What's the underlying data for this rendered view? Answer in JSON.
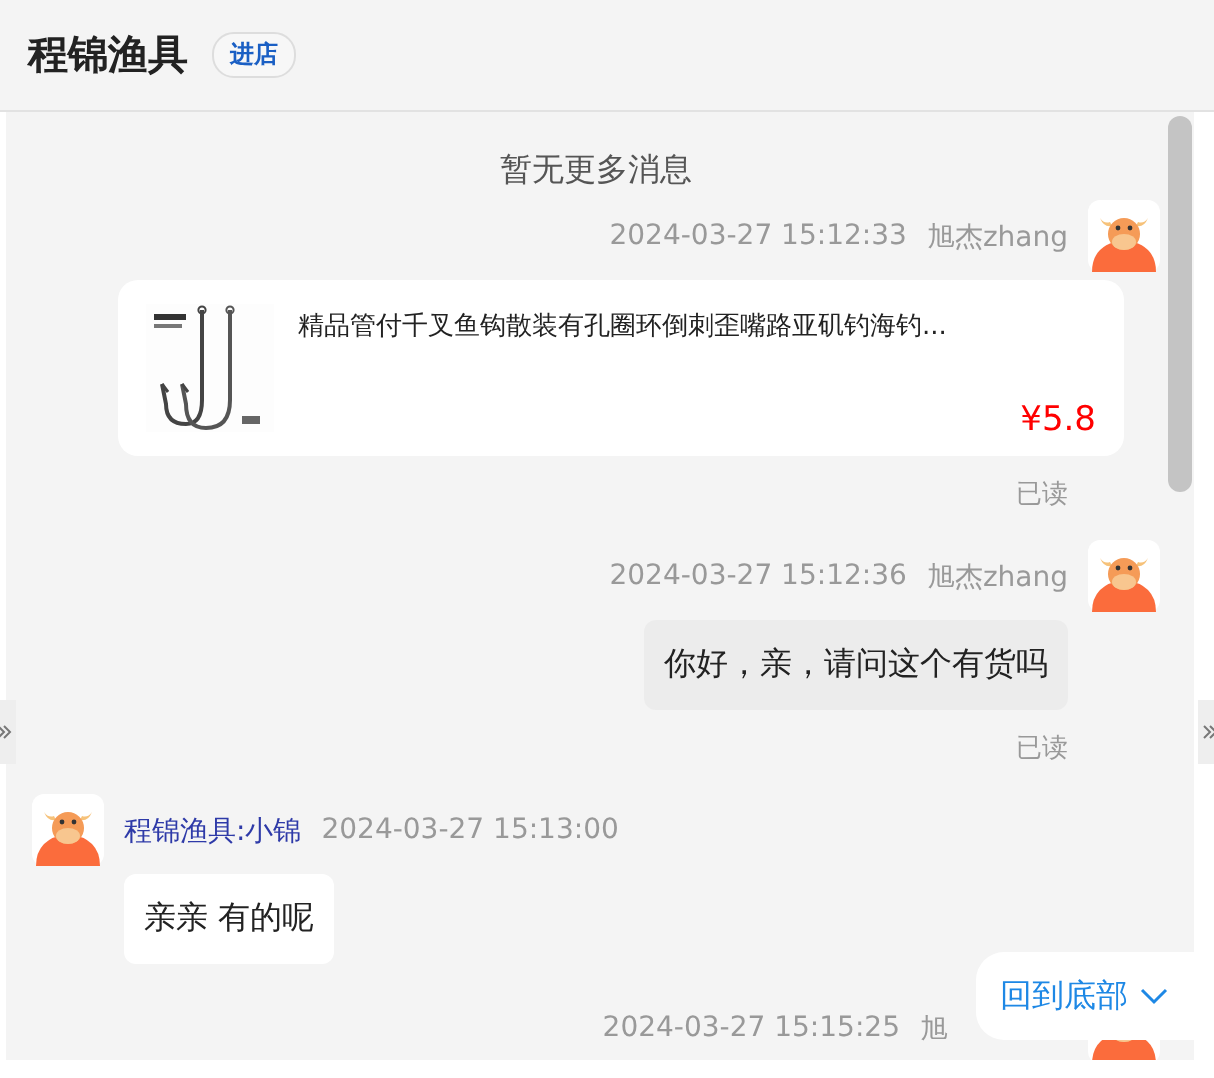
{
  "header": {
    "title": "程锦渔具",
    "shop_button": "进店"
  },
  "chat": {
    "notice": "暂无更多消息",
    "messages": [
      {
        "kind": "product",
        "outgoing": true,
        "time": "2024-03-27 15:12:33",
        "sender": "旭杰zhang",
        "product_title": "精品管付千叉鱼钩散装有孔圈环倒刺歪嘴路亚矶钓海钓...",
        "price": "¥5.8",
        "receipt": "已读"
      },
      {
        "kind": "text",
        "outgoing": true,
        "time": "2024-03-27 15:12:36",
        "sender": "旭杰zhang",
        "text": "你好，亲，请问这个有货吗",
        "receipt": "已读"
      },
      {
        "kind": "text",
        "outgoing": false,
        "time": "2024-03-27 15:13:00",
        "sender": "程锦渔具:小锦",
        "text": "亲亲 有的呢"
      },
      {
        "kind": "partial",
        "outgoing": true,
        "time": "2024-03-27 15:15:25",
        "sender": "旭"
      }
    ],
    "back_to_bottom": "回到底部"
  }
}
